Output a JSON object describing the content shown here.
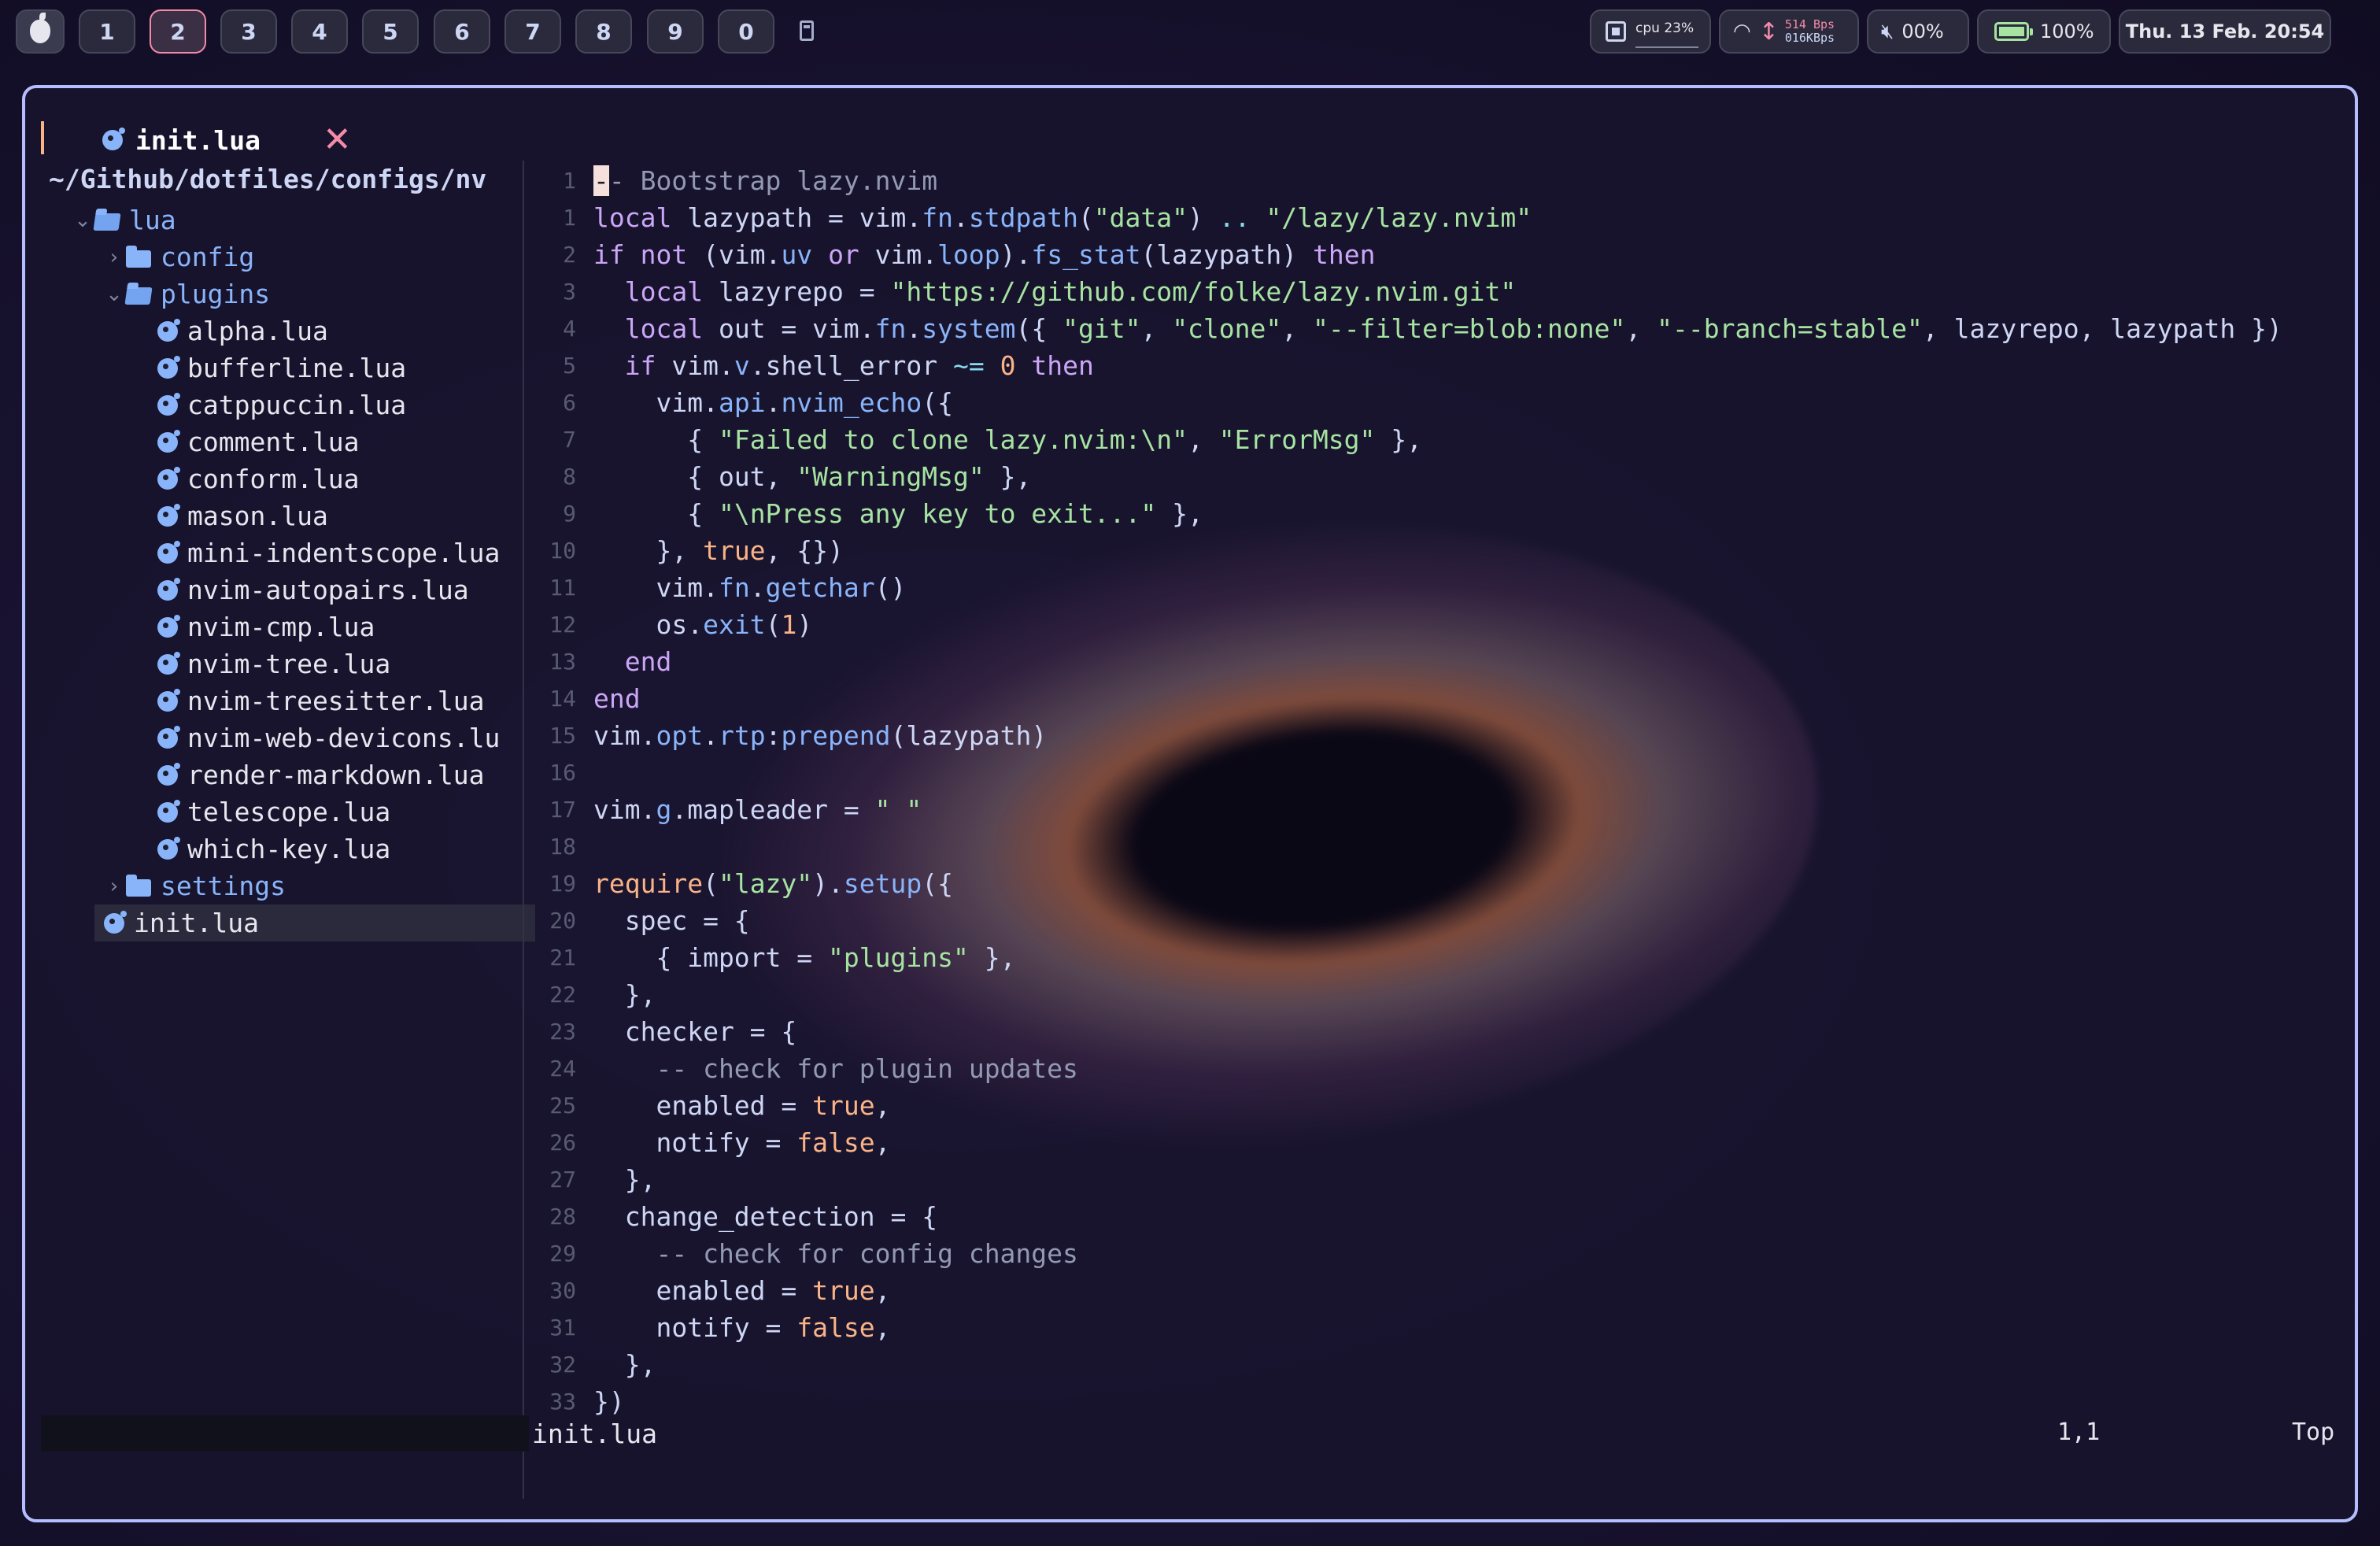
{
  "topbar": {
    "workspaces": [
      "1",
      "2",
      "3",
      "4",
      "5",
      "6",
      "7",
      "8",
      "9",
      "0"
    ],
    "active_workspace": "2",
    "cpu_label": "cpu 23%",
    "net_up": "514 Bps",
    "net_down": "016KBps",
    "volume": "00%",
    "battery": "100%",
    "datetime": "Thu. 13 Feb. 20:54"
  },
  "tab": {
    "name": "init.lua",
    "close_glyph": "✕"
  },
  "tree": {
    "root": "~/Github/dotfiles/configs/nv",
    "items": [
      {
        "kind": "dir",
        "open": true,
        "depth": 0,
        "name": "lua"
      },
      {
        "kind": "dir",
        "open": false,
        "depth": 1,
        "name": "config"
      },
      {
        "kind": "dir",
        "open": true,
        "depth": 1,
        "name": "plugins"
      },
      {
        "kind": "file",
        "depth": 2,
        "name": "alpha.lua"
      },
      {
        "kind": "file",
        "depth": 2,
        "name": "bufferline.lua"
      },
      {
        "kind": "file",
        "depth": 2,
        "name": "catppuccin.lua"
      },
      {
        "kind": "file",
        "depth": 2,
        "name": "comment.lua"
      },
      {
        "kind": "file",
        "depth": 2,
        "name": "conform.lua"
      },
      {
        "kind": "file",
        "depth": 2,
        "name": "mason.lua"
      },
      {
        "kind": "file",
        "depth": 2,
        "name": "mini-indentscope.lua"
      },
      {
        "kind": "file",
        "depth": 2,
        "name": "nvim-autopairs.lua"
      },
      {
        "kind": "file",
        "depth": 2,
        "name": "nvim-cmp.lua"
      },
      {
        "kind": "file",
        "depth": 2,
        "name": "nvim-tree.lua"
      },
      {
        "kind": "file",
        "depth": 2,
        "name": "nvim-treesitter.lua"
      },
      {
        "kind": "file",
        "depth": 2,
        "name": "nvim-web-devicons.lu"
      },
      {
        "kind": "file",
        "depth": 2,
        "name": "render-markdown.lua"
      },
      {
        "kind": "file",
        "depth": 2,
        "name": "telescope.lua"
      },
      {
        "kind": "file",
        "depth": 2,
        "name": "which-key.lua"
      },
      {
        "kind": "dir",
        "open": false,
        "depth": 1,
        "name": "settings"
      },
      {
        "kind": "file",
        "depth": 0,
        "name": "init.lua",
        "selected": true
      }
    ]
  },
  "code": {
    "lines": [
      {
        "n": "1",
        "t": [
          [
            "cursor",
            "-"
          ],
          [
            "cm",
            "- Bootstrap lazy.nvim"
          ]
        ]
      },
      {
        "n": "1",
        "t": [
          [
            "kw",
            "local"
          ],
          [
            "var",
            " lazypath = vim."
          ],
          [
            "fn",
            "fn"
          ],
          [
            "var",
            "."
          ],
          [
            "fn",
            "stdpath"
          ],
          [
            "var",
            "("
          ],
          [
            "str",
            "\"data\""
          ],
          [
            "var",
            ") "
          ],
          [
            "op",
            ".."
          ],
          [
            "var",
            " "
          ],
          [
            "str",
            "\"/lazy/lazy.nvim\""
          ]
        ]
      },
      {
        "n": "2",
        "t": [
          [
            "kw",
            "if not"
          ],
          [
            "var",
            " (vim."
          ],
          [
            "fn",
            "uv"
          ],
          [
            "var",
            " "
          ],
          [
            "kw",
            "or"
          ],
          [
            "var",
            " vim."
          ],
          [
            "fn",
            "loop"
          ],
          [
            "var",
            ")."
          ],
          [
            "fn",
            "fs_stat"
          ],
          [
            "var",
            "(lazypath) "
          ],
          [
            "kw",
            "then"
          ]
        ]
      },
      {
        "n": "3",
        "t": [
          [
            "var",
            "  "
          ],
          [
            "kw",
            "local"
          ],
          [
            "var",
            " lazyrepo = "
          ],
          [
            "str",
            "\"https://github.com/folke/lazy.nvim.git\""
          ]
        ]
      },
      {
        "n": "4",
        "t": [
          [
            "var",
            "  "
          ],
          [
            "kw",
            "local"
          ],
          [
            "var",
            " out = vim."
          ],
          [
            "fn",
            "fn"
          ],
          [
            "var",
            "."
          ],
          [
            "fn",
            "system"
          ],
          [
            "var",
            "({ "
          ],
          [
            "str",
            "\"git\""
          ],
          [
            "var",
            ", "
          ],
          [
            "str",
            "\"clone\""
          ],
          [
            "var",
            ", "
          ],
          [
            "str",
            "\"--filter=blob:none\""
          ],
          [
            "var",
            ", "
          ],
          [
            "str",
            "\"--branch=stable\""
          ],
          [
            "var",
            ", lazyrepo, lazypath })"
          ]
        ]
      },
      {
        "n": "5",
        "t": [
          [
            "var",
            "  "
          ],
          [
            "kw",
            "if"
          ],
          [
            "var",
            " vim."
          ],
          [
            "fn",
            "v"
          ],
          [
            "var",
            ".shell_error "
          ],
          [
            "op",
            "~="
          ],
          [
            "var",
            " "
          ],
          [
            "num",
            "0"
          ],
          [
            "var",
            " "
          ],
          [
            "kw",
            "then"
          ]
        ]
      },
      {
        "n": "6",
        "t": [
          [
            "var",
            "    vim."
          ],
          [
            "fn",
            "api"
          ],
          [
            "var",
            "."
          ],
          [
            "fn",
            "nvim_echo"
          ],
          [
            "var",
            "({"
          ]
        ]
      },
      {
        "n": "7",
        "t": [
          [
            "var",
            "      { "
          ],
          [
            "str",
            "\"Failed to clone lazy.nvim:\\n\""
          ],
          [
            "var",
            ", "
          ],
          [
            "str",
            "\"ErrorMsg\""
          ],
          [
            "var",
            " },"
          ]
        ]
      },
      {
        "n": "8",
        "t": [
          [
            "var",
            "      { out, "
          ],
          [
            "str",
            "\"WarningMsg\""
          ],
          [
            "var",
            " },"
          ]
        ]
      },
      {
        "n": "9",
        "t": [
          [
            "var",
            "      { "
          ],
          [
            "str",
            "\"\\nPress any key to exit...\""
          ],
          [
            "var",
            " },"
          ]
        ]
      },
      {
        "n": "10",
        "t": [
          [
            "var",
            "    }, "
          ],
          [
            "bool",
            "true"
          ],
          [
            "var",
            ", {})"
          ]
        ]
      },
      {
        "n": "11",
        "t": [
          [
            "var",
            "    vim."
          ],
          [
            "fn",
            "fn"
          ],
          [
            "var",
            "."
          ],
          [
            "fn",
            "getchar"
          ],
          [
            "var",
            "()"
          ]
        ]
      },
      {
        "n": "12",
        "t": [
          [
            "var",
            "    os."
          ],
          [
            "fn",
            "exit"
          ],
          [
            "var",
            "("
          ],
          [
            "num",
            "1"
          ],
          [
            "var",
            ")"
          ]
        ]
      },
      {
        "n": "13",
        "t": [
          [
            "var",
            "  "
          ],
          [
            "kw",
            "end"
          ]
        ]
      },
      {
        "n": "14",
        "t": [
          [
            "kw",
            "end"
          ]
        ]
      },
      {
        "n": "15",
        "t": [
          [
            "var",
            "vim."
          ],
          [
            "fn",
            "opt"
          ],
          [
            "var",
            "."
          ],
          [
            "fn",
            "rtp"
          ],
          [
            "var",
            ":"
          ],
          [
            "fn",
            "prepend"
          ],
          [
            "var",
            "(lazypath)"
          ]
        ]
      },
      {
        "n": "16",
        "t": []
      },
      {
        "n": "17",
        "t": [
          [
            "var",
            "vim."
          ],
          [
            "fn",
            "g"
          ],
          [
            "var",
            ".mapleader = "
          ],
          [
            "str",
            "\" \""
          ]
        ]
      },
      {
        "n": "18",
        "t": []
      },
      {
        "n": "19",
        "t": [
          [
            "num",
            "require"
          ],
          [
            "var",
            "("
          ],
          [
            "str",
            "\"lazy\""
          ],
          [
            "var",
            ")."
          ],
          [
            "fn",
            "setup"
          ],
          [
            "var",
            "({"
          ]
        ]
      },
      {
        "n": "20",
        "t": [
          [
            "var",
            "  spec = {"
          ]
        ]
      },
      {
        "n": "21",
        "t": [
          [
            "var",
            "    { import = "
          ],
          [
            "str",
            "\"plugins\""
          ],
          [
            "var",
            " },"
          ]
        ]
      },
      {
        "n": "22",
        "t": [
          [
            "var",
            "  },"
          ]
        ]
      },
      {
        "n": "23",
        "t": [
          [
            "var",
            "  checker = {"
          ]
        ]
      },
      {
        "n": "24",
        "t": [
          [
            "cm",
            "    -- check for plugin updates"
          ]
        ]
      },
      {
        "n": "25",
        "t": [
          [
            "var",
            "    enabled = "
          ],
          [
            "bool",
            "true"
          ],
          [
            "var",
            ","
          ]
        ]
      },
      {
        "n": "26",
        "t": [
          [
            "var",
            "    notify = "
          ],
          [
            "bool",
            "false"
          ],
          [
            "var",
            ","
          ]
        ]
      },
      {
        "n": "27",
        "t": [
          [
            "var",
            "  },"
          ]
        ]
      },
      {
        "n": "28",
        "t": [
          [
            "var",
            "  change_detection = {"
          ]
        ]
      },
      {
        "n": "29",
        "t": [
          [
            "cm",
            "    -- check for config changes"
          ]
        ]
      },
      {
        "n": "30",
        "t": [
          [
            "var",
            "    enabled = "
          ],
          [
            "bool",
            "true"
          ],
          [
            "var",
            ","
          ]
        ]
      },
      {
        "n": "31",
        "t": [
          [
            "var",
            "    notify = "
          ],
          [
            "bool",
            "false"
          ],
          [
            "var",
            ","
          ]
        ]
      },
      {
        "n": "32",
        "t": [
          [
            "var",
            "  },"
          ]
        ]
      },
      {
        "n": "33",
        "t": [
          [
            "var",
            "})"
          ]
        ]
      }
    ]
  },
  "statusline": {
    "file": "init.lua",
    "position": "1,1",
    "scroll": "Top"
  },
  "colors": {
    "accent": "#b4befe",
    "active_ws": "#f38ba8",
    "folder": "#89b4fa",
    "close": "#f38ba8"
  }
}
